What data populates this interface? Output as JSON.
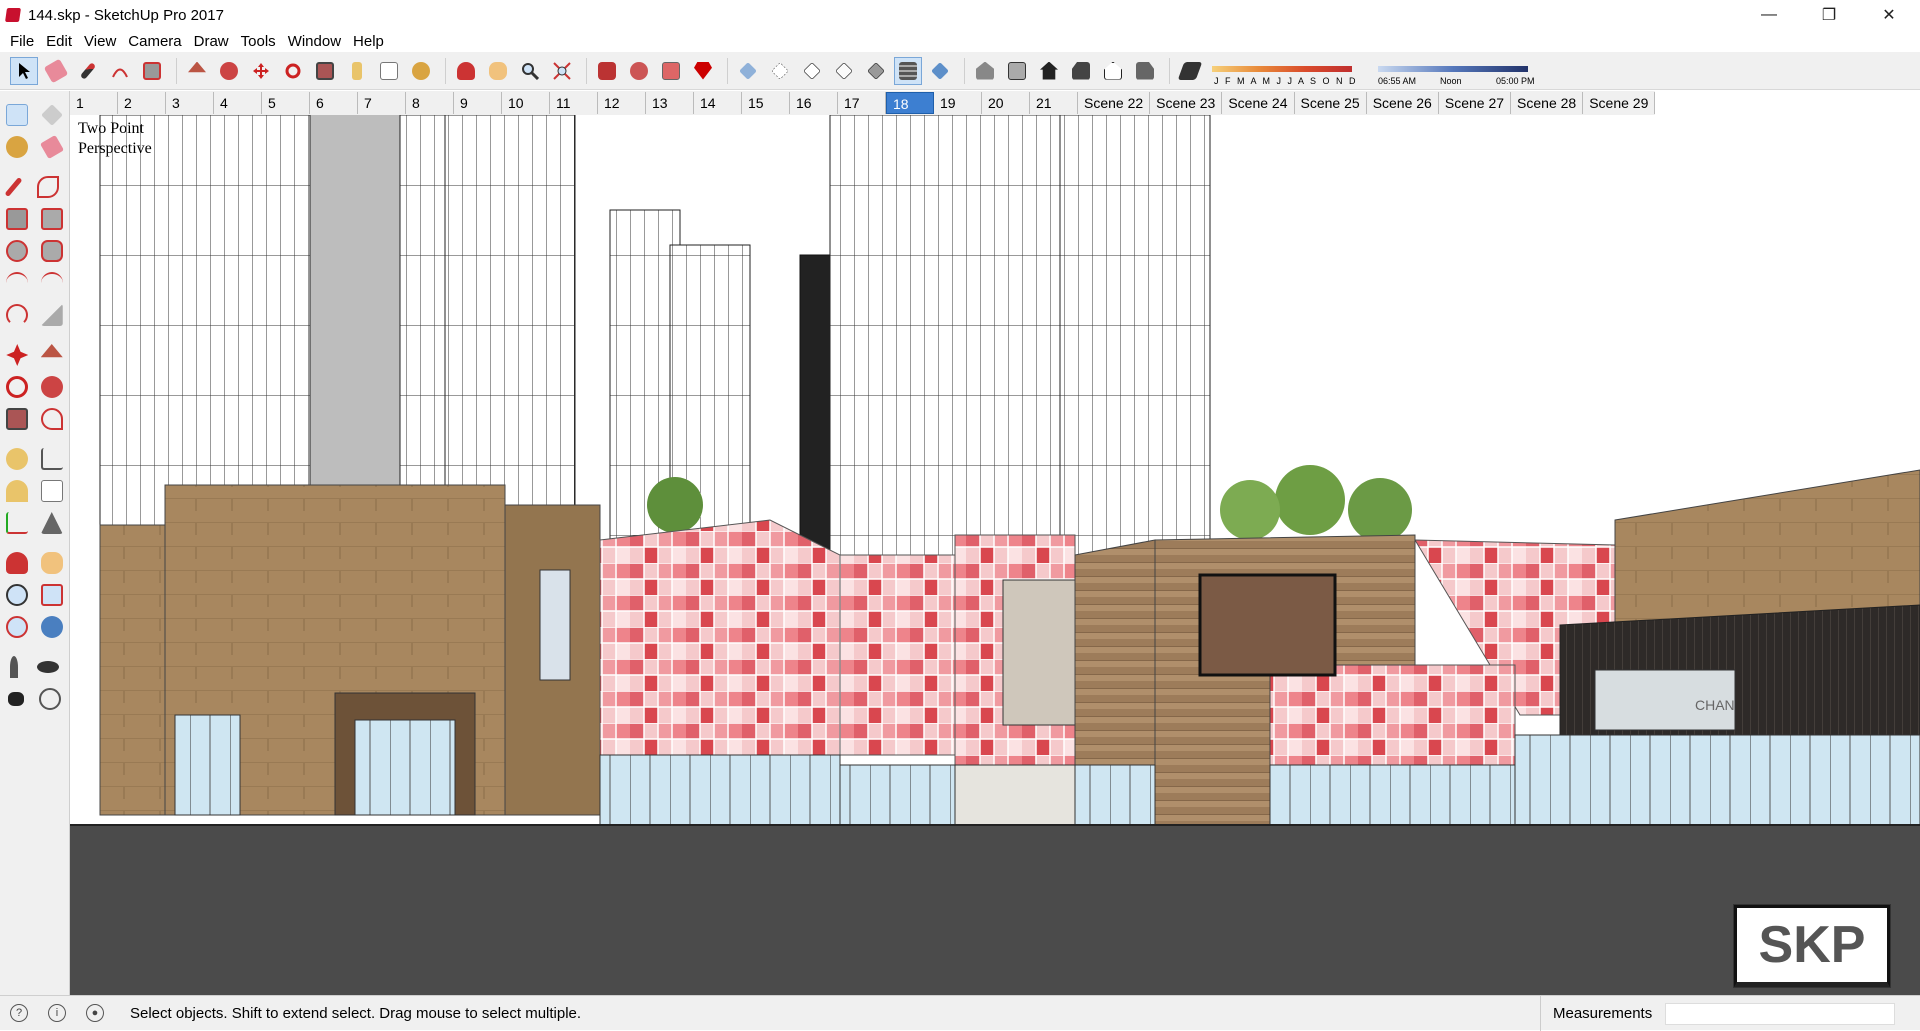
{
  "window": {
    "title": "144.skp - SketchUp Pro 2017",
    "minimize_label": "—",
    "restore_label": "❐",
    "close_label": "✕"
  },
  "menu": [
    "File",
    "Edit",
    "View",
    "Camera",
    "Draw",
    "Tools",
    "Window",
    "Help"
  ],
  "shadow_settings": {
    "months_label": "J F M A M J J A S O N D",
    "time_start": "06:55 AM",
    "time_mid": "Noon",
    "time_end": "05:00 PM"
  },
  "scenes": [
    "1",
    "2",
    "3",
    "4",
    "5",
    "6",
    "7",
    "8",
    "9",
    "10",
    "11",
    "12",
    "13",
    "14",
    "15",
    "16",
    "17",
    "18",
    "19",
    "20",
    "21",
    "Scene 22",
    "Scene 23",
    "Scene 24",
    "Scene 25",
    "Scene 26",
    "Scene 27",
    "Scene 28",
    "Scene 29"
  ],
  "active_scene": "18",
  "viewport": {
    "camera_label_line1": "Two Point",
    "camera_label_line2": "Perspective",
    "billboard_text": "CHAN"
  },
  "status": {
    "message": "Select objects. Shift to extend select. Drag mouse to select multiple.",
    "measurements_label": "Measurements",
    "measurements_value": ""
  },
  "badge": {
    "text": "SKP"
  },
  "colors": {
    "accent": "#3d7fd1",
    "ground": "#4b4b4b",
    "facade_tan": "#a8875f",
    "facade_red": "#e0606a"
  }
}
